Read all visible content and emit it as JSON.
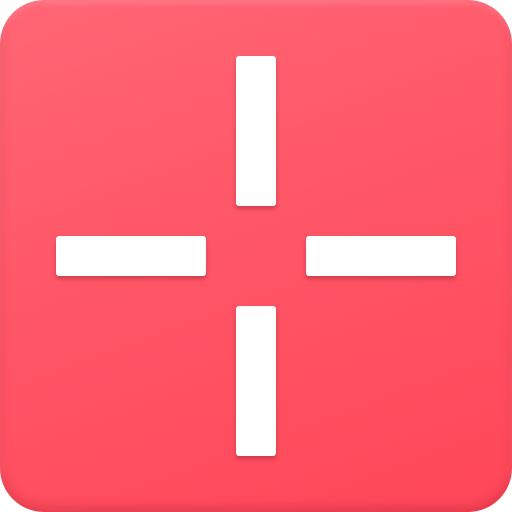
{
  "icon": {
    "name": "crosshair-icon",
    "background_color": "#ff5566",
    "mark_color": "#ffffff"
  }
}
